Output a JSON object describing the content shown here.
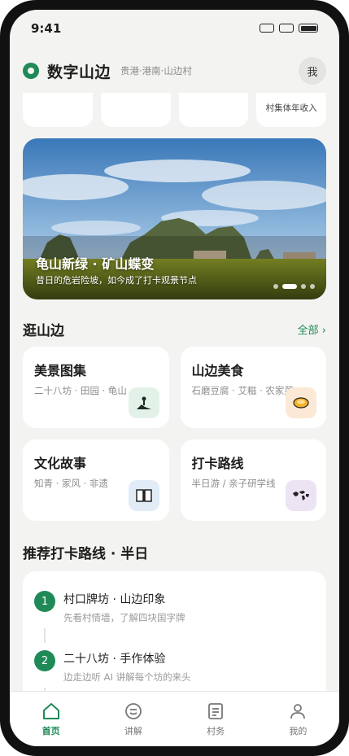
{
  "status_bar": {
    "time": "9:41"
  },
  "header": {
    "title": "数字山边",
    "subtitle": "贵港·港南·山边村",
    "avatar_label": "我"
  },
  "stats": [
    {
      "label": ""
    },
    {
      "label": ""
    },
    {
      "label": ""
    },
    {
      "label": "村集体年收入"
    }
  ],
  "banner": {
    "title": "龟山新绿 · 矿山蝶变",
    "subtitle": "昔日的危岩险坡，如今成了打卡观景节点",
    "slide_count": 4,
    "active_slide": 2
  },
  "explore": {
    "title": "逛山边",
    "more_label": "全部 ›",
    "tiles": [
      {
        "title": "美景图集",
        "desc": "二十八坊 · 田园 · 龟山",
        "icon": "landscape-icon",
        "icon_bg": "#e3f2e8"
      },
      {
        "title": "山边美食",
        "desc": "石磨豆腐 · 艾糍 · 农家菜",
        "icon": "food-bowl-icon",
        "icon_bg": "#fbe9d6"
      },
      {
        "title": "文化故事",
        "desc": "知青 · 家风 · 非遗",
        "icon": "book-icon",
        "icon_bg": "#e1ecf6"
      },
      {
        "title": "打卡路线",
        "desc": "半日游 / 亲子研学线",
        "icon": "world-map-icon",
        "icon_bg": "#ece3f3"
      }
    ]
  },
  "route": {
    "title": "推荐打卡路线 · 半日",
    "steps": [
      {
        "num": "1",
        "title": "村口牌坊 · 山边印象",
        "desc": "先看村情墙，了解四块国字牌"
      },
      {
        "num": "2",
        "title": "二十八坊 · 手作体验",
        "desc": "边走边听 AI 讲解每个坊的来头"
      }
    ]
  },
  "tabbar": {
    "items": [
      {
        "label": "首页",
        "icon": "home-icon",
        "active": true
      },
      {
        "label": "讲解",
        "icon": "guide-chat-icon",
        "active": false
      },
      {
        "label": "村务",
        "icon": "document-icon",
        "active": false
      },
      {
        "label": "我的",
        "icon": "user-icon",
        "active": false
      }
    ]
  },
  "colors": {
    "accent": "#1f8a57",
    "background": "#f3f4f1",
    "card": "#ffffff"
  }
}
